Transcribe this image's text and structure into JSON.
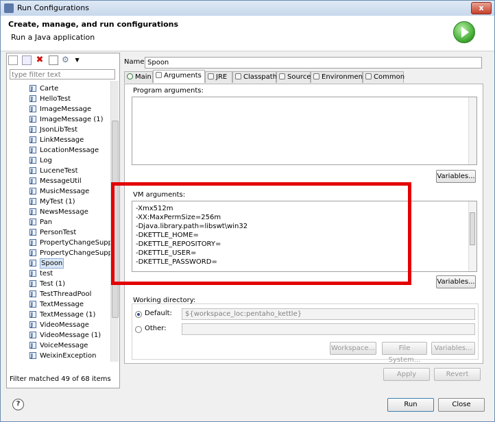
{
  "window": {
    "title": "Run Configurations",
    "close_glyph": "x"
  },
  "header": {
    "title": "Create, manage, and run configurations",
    "subtitle": "Run a Java application"
  },
  "filter": {
    "placeholder": "type filter text"
  },
  "list": {
    "items": [
      "Carte",
      "HelloTest",
      "ImageMessage",
      "ImageMessage (1)",
      "JsonLibTest",
      "LinkMessage",
      "LocationMessage",
      "Log",
      "LuceneTest",
      "MessageUtil",
      "MusicMessage",
      "MyTest (1)",
      "NewsMessage",
      "Pan",
      "PersonTest",
      "PropertyChangeSuppo",
      "PropertyChangeSuppo",
      "Spoon",
      "test",
      "Test (1)",
      "TestThreadPool",
      "TextMessage",
      "TextMessage (1)",
      "VideoMessage",
      "VideoMessage (1)",
      "VoiceMessage",
      "WeixinException"
    ],
    "selected": "Spoon"
  },
  "status": {
    "filter_matched": "Filter matched 49 of 68 items"
  },
  "name": {
    "label": "Name:",
    "value": "Spoon"
  },
  "tabs": [
    "Main",
    "Arguments",
    "JRE",
    "Classpath",
    "Source",
    "Environment",
    "Common"
  ],
  "program": {
    "label": "Program arguments:",
    "variables": "Variables..."
  },
  "vm": {
    "label": "VM arguments:",
    "lines": [
      "-Xmx512m",
      "-XX:MaxPermSize=256m",
      "-Djava.library.path=libswt\\win32",
      "-DKETTLE_HOME=",
      "-DKETTLE_REPOSITORY=",
      "-DKETTLE_USER=",
      "-DKETTLE_PASSWORD="
    ],
    "variables": "Variables..."
  },
  "workdir": {
    "label": "Working directory:",
    "default_label": "Default:",
    "default_value": "${workspace_loc:pentaho_kettle}",
    "other_label": "Other:",
    "workspace_btn": "Workspace...",
    "filesystem_btn": "File System...",
    "variables_btn": "Variables..."
  },
  "actions": {
    "apply": "Apply",
    "revert": "Revert",
    "run": "Run",
    "close": "Close",
    "help": "?"
  },
  "colors": {
    "highlight": "#e30000",
    "selection": "#dbe8f8"
  }
}
